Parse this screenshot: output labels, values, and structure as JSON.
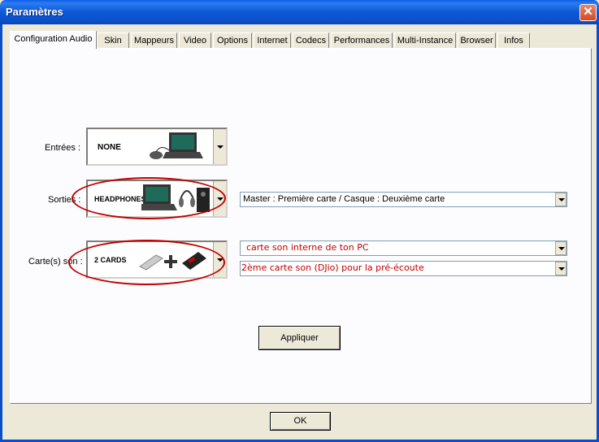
{
  "window": {
    "title": "Paramètres",
    "close_icon": "close-icon"
  },
  "tabs": [
    {
      "label": "Configuration Audio",
      "active": true
    },
    {
      "label": "Skin"
    },
    {
      "label": "Mappeurs"
    },
    {
      "label": "Video"
    },
    {
      "label": "Options"
    },
    {
      "label": "Internet"
    },
    {
      "label": "Codecs"
    },
    {
      "label": "Performances"
    },
    {
      "label": "Multi-Instance"
    },
    {
      "label": "Browser"
    },
    {
      "label": "Infos"
    }
  ],
  "audio": {
    "inputs": {
      "label": "Entrées :",
      "image_text": "NONE"
    },
    "outputs": {
      "label": "Sorties :",
      "image_text": "HEADPHONES",
      "combo_value": "Master : Première carte / Casque : Deuxième carte"
    },
    "cards": {
      "label": "Carte(s) son :",
      "image_text": "2 CARDS",
      "card1_value": "carte son interne de ton PC",
      "card2_value": "2ème carte son (DJio) pour la pré-écoute"
    },
    "apply_label": "Appliquer"
  },
  "ok_label": "OK",
  "colors": {
    "titlebar": "#0b4fc8",
    "annotation": "#c00000",
    "face": "#ece9d8"
  }
}
